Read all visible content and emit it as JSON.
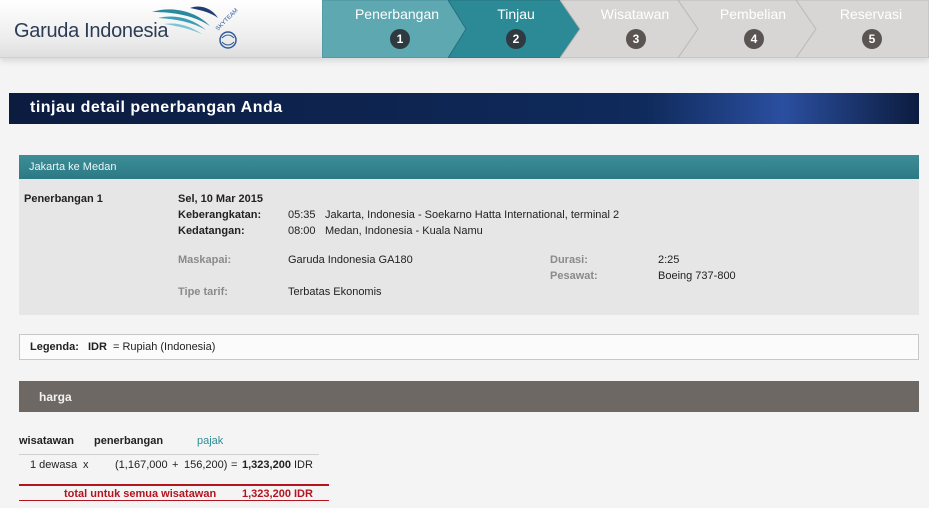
{
  "header": {
    "logo_text": "Garuda Indonesia",
    "logo_badge": "SKYTEAM",
    "steps": [
      {
        "label": "Penerbangan",
        "num": "1",
        "state": "done"
      },
      {
        "label": "Tinjau",
        "num": "2",
        "state": "active"
      },
      {
        "label": "Wisatawan",
        "num": "3",
        "state": "pending"
      },
      {
        "label": "Pembelian",
        "num": "4",
        "state": "pending"
      },
      {
        "label": "Reservasi",
        "num": "5",
        "state": "pending"
      }
    ],
    "colors": {
      "active": "#2c8a96",
      "done": "#5ea8b1",
      "pending": "#d8d6d4"
    }
  },
  "page_title": "tinjau detail penerbangan Anda",
  "flight": {
    "route": "Jakarta ke Medan",
    "label": "Penerbangan 1",
    "date": "Sel, 10 Mar 2015",
    "departure_label": "Keberangkatan:",
    "departure_time": "05:35",
    "departure_place": "Jakarta, Indonesia - Soekarno Hatta International, terminal 2",
    "arrival_label": "Kedatangan:",
    "arrival_time": "08:00",
    "arrival_place": "Medan, Indonesia - Kuala Namu",
    "airline_label": "Maskapai:",
    "airline_value": "Garuda Indonesia GA180",
    "duration_label": "Durasi:",
    "duration_value": "2:25",
    "aircraft_label": "Pesawat:",
    "aircraft_value": "Boeing 737-800",
    "fare_label": "Tipe tarif:",
    "fare_value": "Terbatas Ekonomis"
  },
  "legend": {
    "label": "Legenda:",
    "code": "IDR",
    "desc": "= Rupiah (Indonesia)"
  },
  "price": {
    "title": "harga",
    "col_traveller": "wisatawan",
    "col_fare": "penerbangan",
    "col_tax": "pajak",
    "row_traveller": "1 dewasa",
    "row_times": "x",
    "row_fare": "(1,167,000",
    "row_plus": "+",
    "row_tax": "156,200)",
    "row_equals": "=",
    "row_amount": "1,323,200",
    "row_currency": "IDR",
    "total_label": "total untuk semua wisatawan",
    "total_amount": "1,323,200",
    "total_currency": "IDR"
  }
}
